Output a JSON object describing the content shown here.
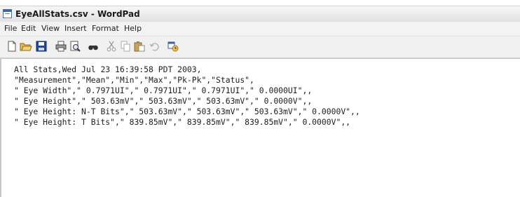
{
  "window": {
    "title": "EyeAllStats.csv - WordPad"
  },
  "menu": [
    "File",
    "Edit",
    "View",
    "Insert",
    "Format",
    "Help"
  ],
  "toolbar": {
    "icons": [
      "new-document-icon",
      "open-folder-icon",
      "save-icon",
      "print-icon",
      "print-preview-icon",
      "find-icon",
      "cut-icon",
      "copy-icon",
      "paste-icon",
      "undo-icon",
      "insert-datetime-icon"
    ]
  },
  "document": {
    "lines": [
      "All Stats,Wed Jul 23 16:39:58 PDT 2003,",
      "\"Measurement\",\"Mean\",\"Min\",\"Max\",\"Pk-Pk\",\"Status\",",
      "\" Eye Width\",\" 0.7971UI\",\" 0.7971UI\",\" 0.7971UI\",\" 0.0000UI\",,",
      "\" Eye Height\",\" 503.63mV\",\" 503.63mV\",\" 503.63mV\",\" 0.0000V\",,",
      "\" Eye Height: N-T Bits\",\" 503.63mV\",\" 503.63mV\",\" 503.63mV\",\" 0.0000V\",,",
      "\" Eye Height: T Bits\",\" 839.85mV\",\" 839.85mV\",\" 839.85mV\",\" 0.0000V\",,"
    ]
  }
}
